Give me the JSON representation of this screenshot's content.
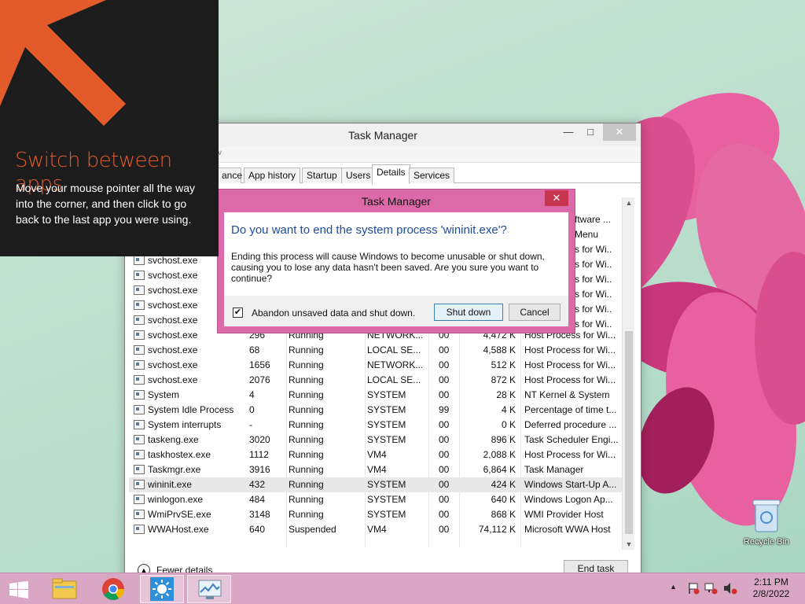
{
  "overlay": {
    "heading": "Switch between apps",
    "text": "Move your mouse pointer all the way into the corner, and then click to go back to the last app you were using."
  },
  "task_manager": {
    "title": "Task Manager",
    "menu_fragment": "v",
    "tabs": [
      "ance",
      "App history",
      "Startup",
      "Users",
      "Details",
      "Services"
    ],
    "active_tab": "Details",
    "rows": [
      {
        "name": "svchost.exe",
        "pid": "",
        "status": "",
        "user": "",
        "cpu": "",
        "mem": "",
        "desc": ""
      },
      {
        "name": "svchost.exe",
        "pid": "",
        "status": "",
        "user": "",
        "cpu": "",
        "mem": "",
        "desc": ""
      },
      {
        "name": "svchost.exe",
        "pid": "",
        "status": "",
        "user": "",
        "cpu": "",
        "mem": "",
        "desc": ""
      },
      {
        "name": "svchost.exe",
        "pid": "",
        "status": "",
        "user": "",
        "cpu": "",
        "mem": "",
        "desc": ""
      },
      {
        "name": "svchost.exe",
        "pid": "",
        "status": "",
        "user": "",
        "cpu": "",
        "mem": "",
        "desc": ""
      },
      {
        "name": "svchost.exe",
        "pid": "296",
        "status": "Running",
        "user": "NETWORK...",
        "cpu": "00",
        "mem": "4,472 K",
        "desc": "Host Process for Wi..."
      },
      {
        "name": "svchost.exe",
        "pid": "68",
        "status": "Running",
        "user": "LOCAL SE...",
        "cpu": "00",
        "mem": "4,588 K",
        "desc": "Host Process for Wi..."
      },
      {
        "name": "svchost.exe",
        "pid": "1656",
        "status": "Running",
        "user": "NETWORK...",
        "cpu": "00",
        "mem": "512 K",
        "desc": "Host Process for Wi..."
      },
      {
        "name": "svchost.exe",
        "pid": "2076",
        "status": "Running",
        "user": "LOCAL SE...",
        "cpu": "00",
        "mem": "872 K",
        "desc": "Host Process for Wi..."
      },
      {
        "name": "System",
        "pid": "4",
        "status": "Running",
        "user": "SYSTEM",
        "cpu": "00",
        "mem": "28 K",
        "desc": "NT Kernel & System"
      },
      {
        "name": "System Idle Process",
        "pid": "0",
        "status": "Running",
        "user": "SYSTEM",
        "cpu": "99",
        "mem": "4 K",
        "desc": "Percentage of time t..."
      },
      {
        "name": "System interrupts",
        "pid": "-",
        "status": "Running",
        "user": "SYSTEM",
        "cpu": "00",
        "mem": "0 K",
        "desc": "Deferred procedure ..."
      },
      {
        "name": "taskeng.exe",
        "pid": "3020",
        "status": "Running",
        "user": "SYSTEM",
        "cpu": "00",
        "mem": "896 K",
        "desc": "Task Scheduler Engi..."
      },
      {
        "name": "taskhostex.exe",
        "pid": "1112",
        "status": "Running",
        "user": "VM4",
        "cpu": "00",
        "mem": "2,088 K",
        "desc": "Host Process for Wi..."
      },
      {
        "name": "Taskmgr.exe",
        "pid": "3916",
        "status": "Running",
        "user": "VM4",
        "cpu": "00",
        "mem": "6,864 K",
        "desc": "Task Manager"
      },
      {
        "name": "wininit.exe",
        "pid": "432",
        "status": "Running",
        "user": "SYSTEM",
        "cpu": "00",
        "mem": "424 K",
        "desc": "Windows Start-Up A..."
      },
      {
        "name": "winlogon.exe",
        "pid": "484",
        "status": "Running",
        "user": "SYSTEM",
        "cpu": "00",
        "mem": "640 K",
        "desc": "Windows Logon Ap..."
      },
      {
        "name": "WmiPrvSE.exe",
        "pid": "3148",
        "status": "Running",
        "user": "SYSTEM",
        "cpu": "00",
        "mem": "868 K",
        "desc": "WMI Provider Host"
      },
      {
        "name": "WWAHost.exe",
        "pid": "640",
        "status": "Suspended",
        "user": "VM4",
        "cpu": "00",
        "mem": "74,112 K",
        "desc": "Microsoft WWA Host"
      }
    ],
    "partial_desc_above": [
      "ftware ...",
      "Menu",
      "s for Wi...",
      "s for Wi...",
      "s for Wi...",
      "s for Wi...",
      "s for Wi...",
      "s for Wi..."
    ],
    "selected_row": "wininit.exe",
    "fewer_details": "Fewer details",
    "end_task": "End task"
  },
  "dialog": {
    "title": "Task Manager",
    "heading": "Do you want to end the system process 'wininit.exe'?",
    "text": "Ending this process will cause Windows to become unusable or shut down, causing you to lose any data hasn't been saved. Are you sure you want to continue?",
    "checkbox_label": "Abandon unsaved data and shut down.",
    "checkbox_checked": true,
    "shutdown_label": "Shut down",
    "cancel_label": "Cancel"
  },
  "desktop": {
    "recycle_bin": "Recycle Bin"
  },
  "taskbar": {
    "time": "2:11 PM",
    "date": "2/8/2022"
  },
  "colors": {
    "overlay_accent": "#e35a2b",
    "dialog_frame": "#dc6aa8",
    "taskbar": "#d9a7c4"
  }
}
